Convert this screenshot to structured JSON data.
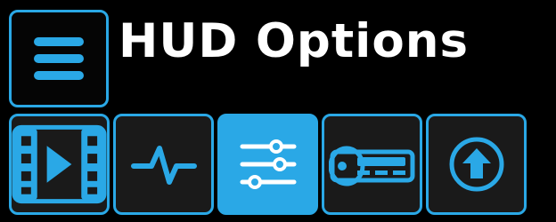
{
  "header": {
    "title": "HUD Options",
    "menu_icon": "hamburger-menu-icon"
  },
  "toolbar": {
    "items": [
      {
        "id": "video",
        "icon": "film-play-icon",
        "active": false
      },
      {
        "id": "pulse",
        "icon": "pulse-waveform-icon",
        "active": false
      },
      {
        "id": "sliders",
        "icon": "sliders-icon",
        "active": true
      },
      {
        "id": "radio",
        "icon": "car-radio-icon",
        "active": false
      },
      {
        "id": "upload",
        "icon": "up-arrow-circle-icon",
        "active": false
      }
    ]
  },
  "colors": {
    "accent": "#2aa8e6",
    "button_bg": "#1a1a1a",
    "background": "#000000",
    "title_text": "#ffffff",
    "active_icon": "#ffffff"
  }
}
